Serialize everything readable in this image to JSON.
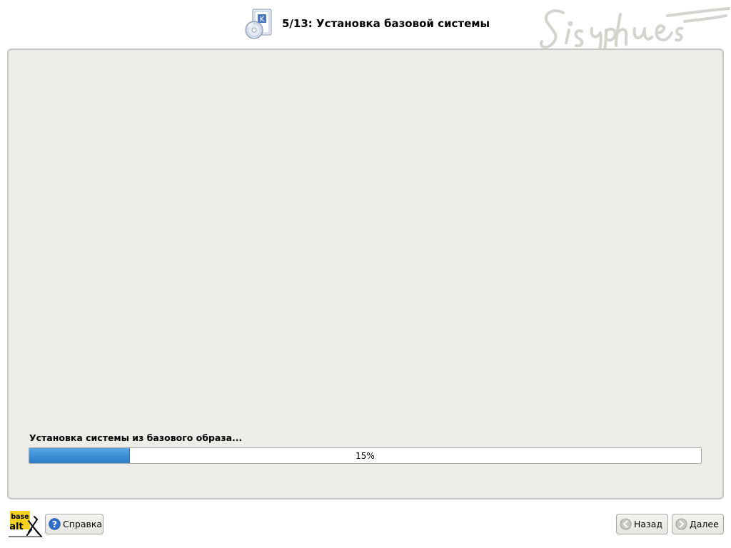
{
  "header": {
    "title": "5/13: Установка базовой системы",
    "icon": "install-disc-icon",
    "signature_icon": "sisyphus-signature-icon"
  },
  "main": {
    "status_text": "Установка системы из базового образа...",
    "progress": {
      "value_percent": 15,
      "label": "15%"
    }
  },
  "footer": {
    "logo_text_top": "base",
    "logo_text_bottom": "alt",
    "help_label": "Справка",
    "help_icon": "help-icon",
    "back_label": "Назад",
    "back_icon": "arrow-left-icon",
    "next_label": "Далее",
    "next_icon": "arrow-right-icon"
  },
  "colors": {
    "panel_bg": "#edece9",
    "progress_fill": "#3d8fd6",
    "logo_yellow": "#f4d21f"
  }
}
